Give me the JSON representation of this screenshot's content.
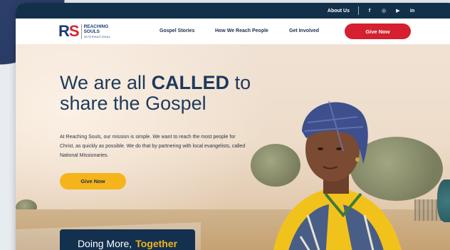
{
  "utility": {
    "about": "About Us",
    "social": [
      {
        "icon": "facebook-icon",
        "glyph": "f"
      },
      {
        "icon": "instagram-icon",
        "glyph": "◎"
      },
      {
        "icon": "youtube-icon",
        "glyph": "▶"
      },
      {
        "icon": "linkedin-icon",
        "glyph": "in"
      }
    ]
  },
  "logo": {
    "mark_r": "R",
    "mark_s": "S",
    "line1": "REACHING",
    "line2": "SOULS",
    "line3": "INTERNATIONAL"
  },
  "nav": {
    "links": [
      "Gospel Stories",
      "How We Reach People",
      "Get Involved"
    ],
    "give_now": "Give Now"
  },
  "hero": {
    "headline_pre": "We are all ",
    "headline_bold": "CALLED",
    "headline_post": " to",
    "headline_line2": "share the Gospel",
    "mission": "At Reaching Souls, our mission is simple. We want to reach the most people for Christ, as quickly as possible. We do that by partnering with local evangelists, called National Missionaries.",
    "give_now": "Give Now"
  },
  "banner": {
    "text": "Doing More,",
    "accent": "Together"
  },
  "colors": {
    "navy": "#12304a",
    "red": "#d42030",
    "gold": "#f4b41a"
  }
}
